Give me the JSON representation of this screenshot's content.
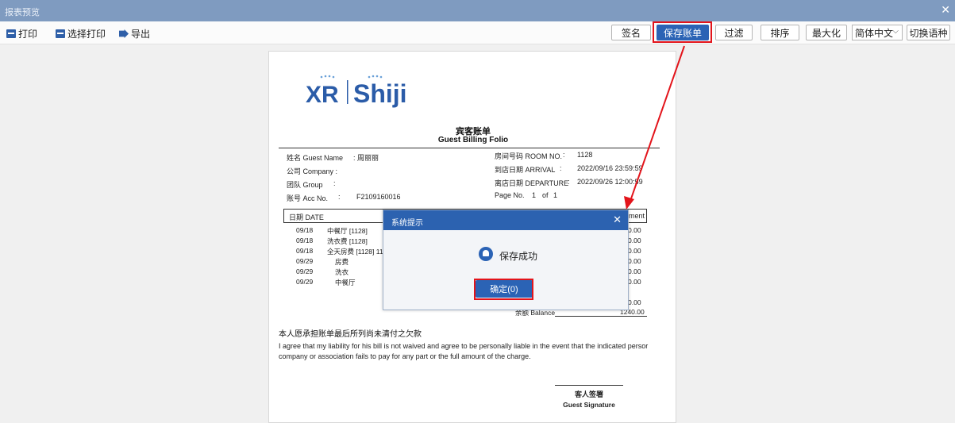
{
  "window": {
    "title": "报表预览",
    "close_glyph": "✕"
  },
  "toolbar": {
    "print_label": "打印",
    "select_print_label": "选择打印",
    "export_label": "导出",
    "sign_label": "签名",
    "save_label": "保存账单",
    "filter_label": "过滤",
    "sort_label": "排序",
    "maximize_label": "最大化",
    "language_value": "简体中文",
    "switch_language_label": "切换语种"
  },
  "document": {
    "logo_brand": "Shiji",
    "logo_mark": "XR",
    "title_cn": "宾客账单",
    "title_en": "Guest Billing Folio",
    "info": {
      "guest_name_label": "姓名 Guest Name",
      "guest_name_value": ": 周丽丽",
      "company_label": "公司 Company :",
      "group_label": "团队 Group",
      "group_colon": ":",
      "acc_label": "账号 Acc No.",
      "acc_colon": ":",
      "acc_value": "F2109160016",
      "room_label": "房间号码 ROOM NO.",
      "room_colon": ":",
      "room_value": "1128",
      "arrival_label": "到店日期 ARRIVAL",
      "arrival_colon": ":",
      "arrival_value": "2022/09/16 23:59:59",
      "departure_label": "离店日期 DEPARTURE",
      "departure_colon": ":",
      "departure_value": "2022/09/26 12:00:59",
      "page_label": "Page No.",
      "page_value": "1",
      "page_of": "of",
      "page_total": "1"
    },
    "table_head": {
      "date": "日期 DATE",
      "payment": "ment"
    },
    "rows": [
      {
        "date": "09/18",
        "desc": "中餐厅  [1128]",
        "amount": "0.00"
      },
      {
        "date": "09/18",
        "desc": "洗衣费  [1128]",
        "amount": "0.00"
      },
      {
        "date": "09/18",
        "desc": "全天房费  [1128] 11",
        "amount": "0.00"
      },
      {
        "date": "09/29",
        "desc": "房费",
        "amount": "0.00"
      },
      {
        "date": "09/29",
        "desc": "洗衣",
        "amount": "0.00"
      },
      {
        "date": "09/29",
        "desc": "中餐厅",
        "amount": "0.00"
      }
    ],
    "extra_amount": "0.00",
    "balance_label": "余额 Balance",
    "balance_value": "1240.00",
    "agree_cn": "本人愿承担账单最后所列尚未清付之欠款",
    "agree_en": "I agree that my liability for his bill is not waived and agree to be personally liable in the event that the indicated persor company or association fails to pay for any part or the full amount of the charge.",
    "signature_cn": "客人签署",
    "signature_en": "Guest Signature"
  },
  "dialog": {
    "title": "系统提示",
    "close_glyph": "✕",
    "message": "保存成功",
    "ok_label": "确定(0)",
    "icon": "bell-icon"
  },
  "colors": {
    "titlebar": "#7f9bc0",
    "accent": "#2b63b5",
    "highlight": "#e3141b"
  }
}
